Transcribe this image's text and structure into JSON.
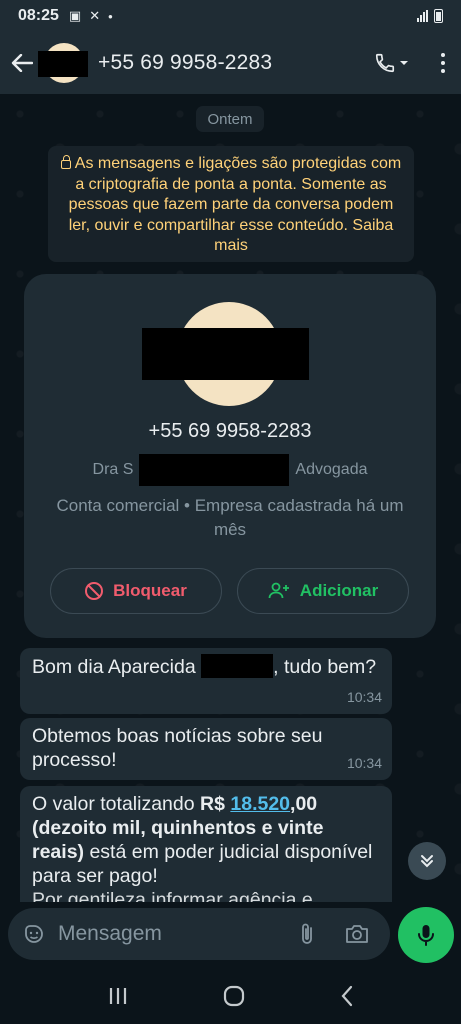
{
  "status_bar": {
    "time": "08:25"
  },
  "header": {
    "title": "+55 69 9958-2283"
  },
  "chat": {
    "date_chip": "Ontem",
    "encryption_notice": "As mensagens e ligações são protegidas com a criptografia de ponta a ponta. Somente as pessoas que fazem parte da conversa podem ler, ouvir e compartilhar esse conteúdo. Saiba mais",
    "contact_card": {
      "phone": "+55 69 9958-2283",
      "role_prefix": "Dra S",
      "role_suffix": "Advogada",
      "description": "Conta comercial • Empresa cadastrada há um mês",
      "block_label": "Bloquear",
      "add_label": "Adicionar"
    },
    "messages": [
      {
        "text_a": "Bom dia Aparecida",
        "text_b": ", tudo bem?",
        "time": "10:34"
      },
      {
        "text": "Obtemos boas notícias sobre seu processo!",
        "time": "10:34"
      },
      {
        "text_a": "O valor totalizando ",
        "bold_a": "R$ ",
        "link": "18.520",
        "bold_b": ",00",
        "bold_c": "(dezoito mil, quinhentos e vinte reais)",
        "text_b": " está em poder judicial disponível para ser pago!",
        "text_c": "Por gentileza informar agência e"
      }
    ]
  },
  "input": {
    "placeholder": "Mensagem"
  },
  "colors": {
    "accent": "#21c063",
    "danger": "#f15c6d",
    "link": "#53bdeb",
    "notice": "#ffd279"
  }
}
